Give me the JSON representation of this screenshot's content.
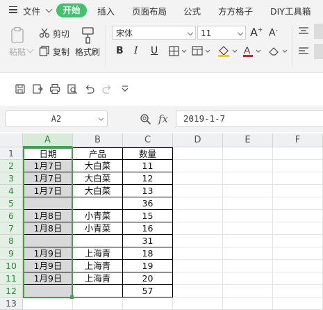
{
  "menu": {
    "file": "文件",
    "start": "开始",
    "insert": "插入",
    "page_layout": "页面布局",
    "formula": "公式",
    "fangfang": "方方格子",
    "diy": "DIY工具箱"
  },
  "ribbon": {
    "paste": "粘贴",
    "cut": "剪切",
    "copy": "复制",
    "format_painter": "格式刷",
    "font_name": "宋体",
    "font_size": "11",
    "bold": "B",
    "italic": "I",
    "underline": "U",
    "grow_font": "A",
    "shrink_font": "A"
  },
  "formula_bar": {
    "name_box": "A2",
    "fx_label": "fx",
    "value": "2019-1-7"
  },
  "columns": [
    "A",
    "B",
    "C",
    "D",
    "E",
    "F"
  ],
  "rows": [
    "1",
    "2",
    "3",
    "4",
    "5",
    "6",
    "7",
    "8",
    "9",
    "10",
    "11",
    "12",
    "13"
  ],
  "cells": [
    [
      "日期",
      "产品",
      "数量"
    ],
    [
      "1月7日",
      "大白菜",
      "11"
    ],
    [
      "1月7日",
      "大白菜",
      "12"
    ],
    [
      "1月7日",
      "大白菜",
      "13"
    ],
    [
      "",
      "",
      "36"
    ],
    [
      "1月8日",
      "小青菜",
      "15"
    ],
    [
      "1月8日",
      "小青菜",
      "16"
    ],
    [
      "",
      "",
      "31"
    ],
    [
      "1月9日",
      "上海青",
      "18"
    ],
    [
      "1月9日",
      "上海青",
      "19"
    ],
    [
      "1月9日",
      "上海青",
      "20"
    ],
    [
      "",
      "",
      "57"
    ]
  ],
  "colors": {
    "accent": "#3ec56c",
    "selection": "#3ba445",
    "underline_red": "#e02020",
    "highlight_yellow": "#f5d000"
  }
}
